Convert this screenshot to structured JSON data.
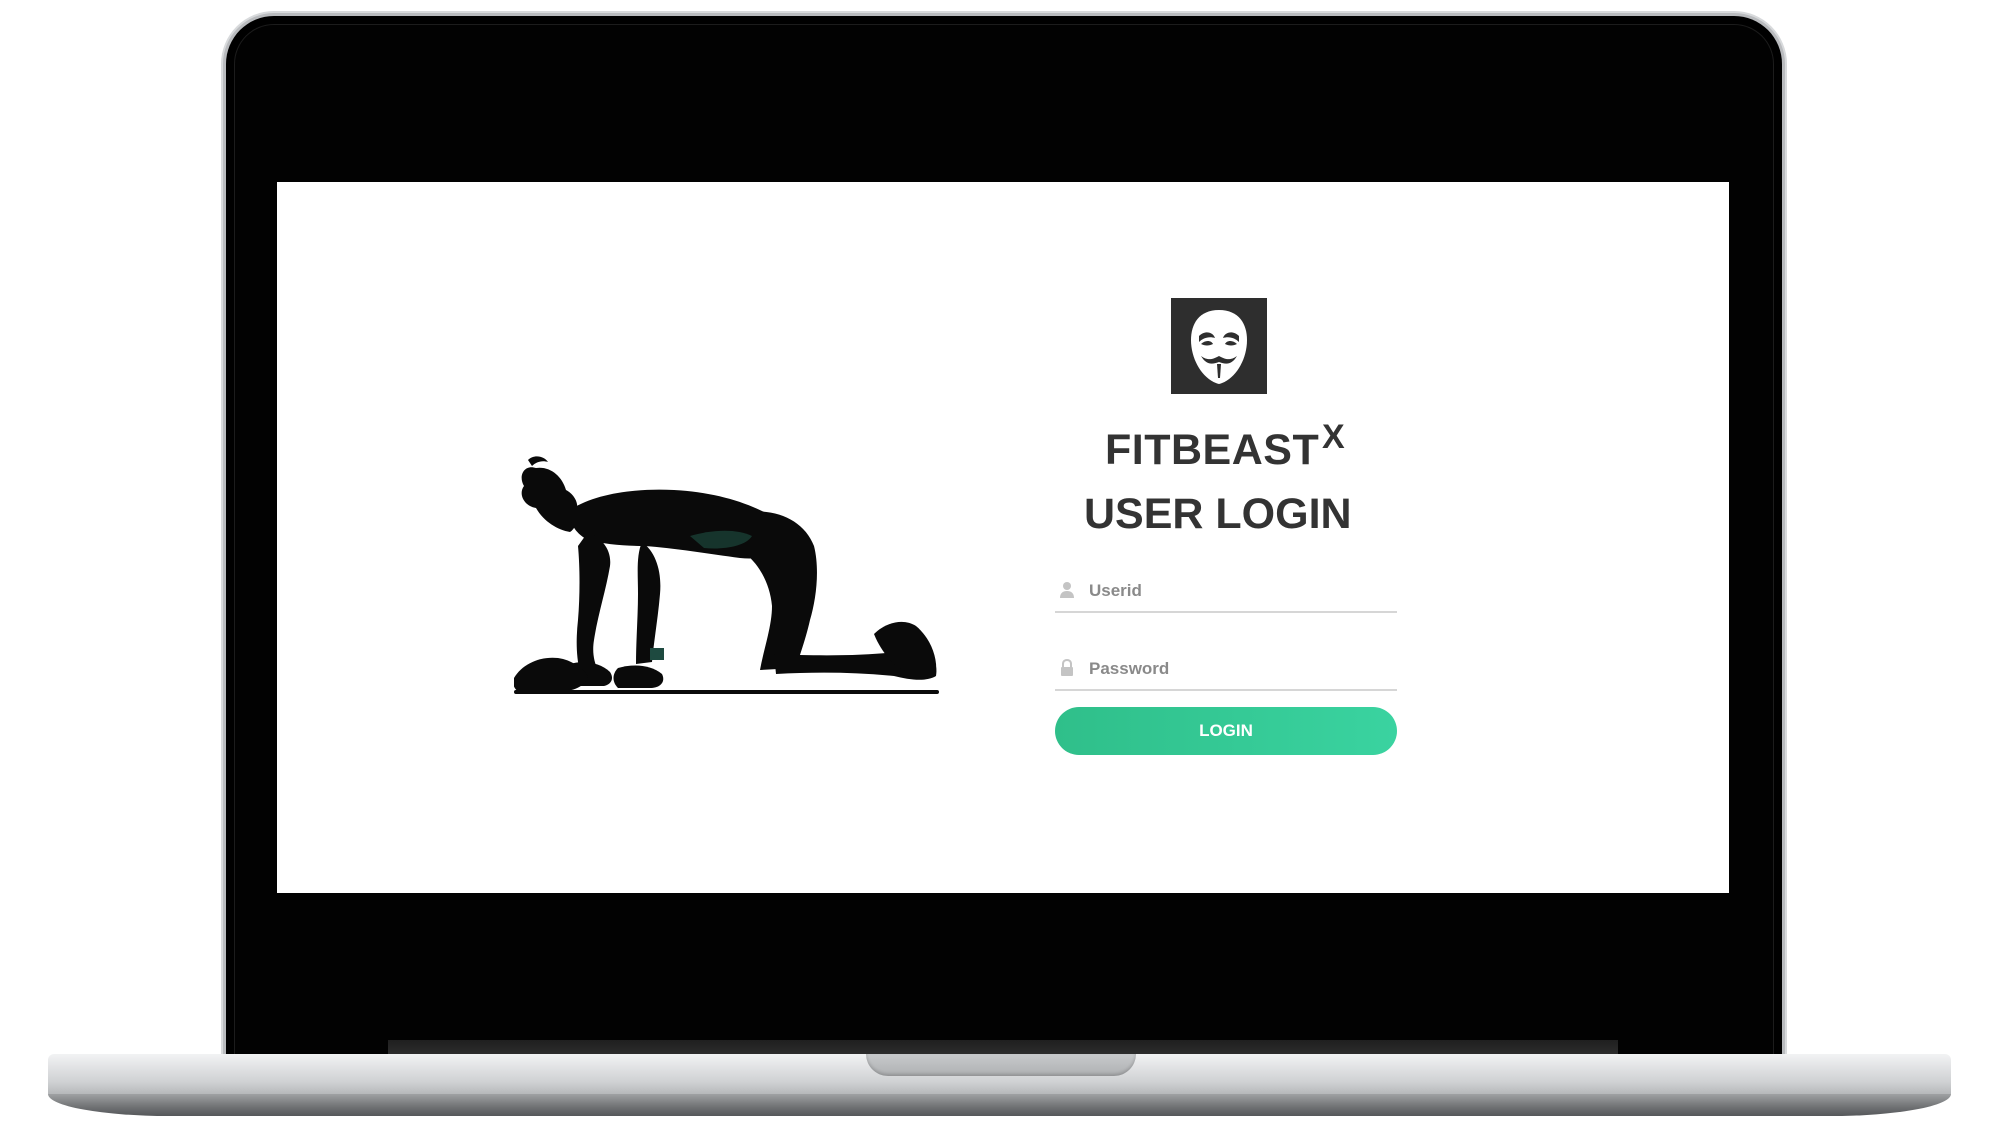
{
  "login": {
    "brand": "FITBEAST",
    "close_label": "X",
    "heading": "USER LOGIN",
    "userid": {
      "placeholder": "Userid",
      "value": ""
    },
    "password": {
      "placeholder": "Password",
      "value": ""
    },
    "button_label": "LOGIN"
  },
  "icons": {
    "logo": "guy-fawkes-mask-icon",
    "userid": "user-icon",
    "password": "lock-icon",
    "close": "close-icon"
  },
  "colors": {
    "button": "#34c996",
    "logo_bg": "#2e2e2e",
    "text": "#333333",
    "field_border": "#d6d6d6"
  }
}
